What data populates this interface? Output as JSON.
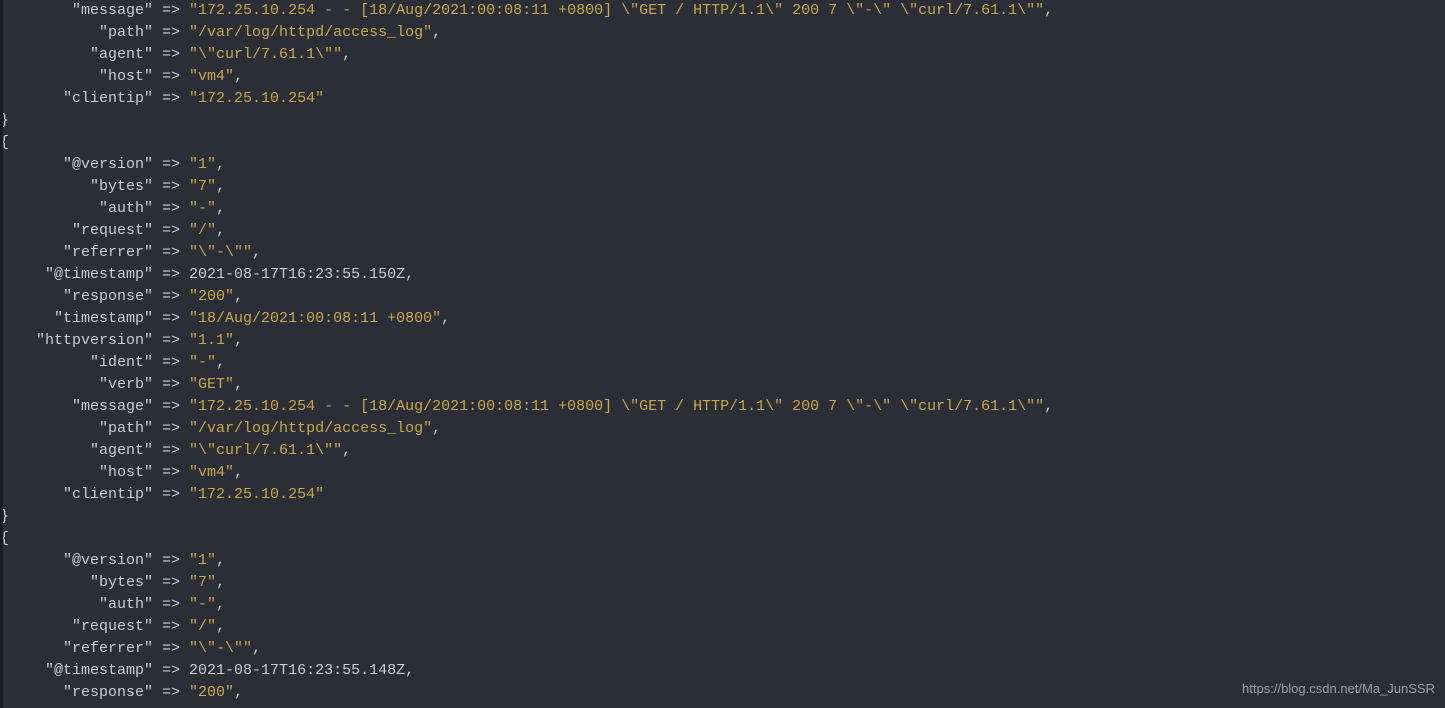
{
  "watermark": "https://blog.csdn.net/Ma_JunSSR",
  "block1_tail": [
    {
      "key": "\"message\"",
      "indent": 8,
      "arrow": " => ",
      "value": "\"172.25.10.254 - - [18/Aug/2021:00:08:11 +0800] \\\"GET / HTTP/1.1\\\" 200 7 \\\"-\\\" \\\"curl/7.61.1\\\"\"",
      "trail": ","
    },
    {
      "key": "\"path\"",
      "indent": 11,
      "arrow": " => ",
      "value": "\"/var/log/httpd/access_log\"",
      "trail": ","
    },
    {
      "key": "\"agent\"",
      "indent": 10,
      "arrow": " => ",
      "value": "\"\\\"curl/7.61.1\\\"\"",
      "trail": ","
    },
    {
      "key": "\"host\"",
      "indent": 11,
      "arrow": " => ",
      "value": "\"vm4\"",
      "trail": ","
    },
    {
      "key": "\"clientip\"",
      "indent": 7,
      "arrow": " => ",
      "value": "\"172.25.10.254\"",
      "trail": ""
    }
  ],
  "block2": [
    {
      "key": "\"@version\"",
      "indent": 7,
      "arrow": " => ",
      "value": "\"1\"",
      "trail": ","
    },
    {
      "key": "\"bytes\"",
      "indent": 10,
      "arrow": " => ",
      "value": "\"7\"",
      "trail": ","
    },
    {
      "key": "\"auth\"",
      "indent": 11,
      "arrow": " => ",
      "value": "\"-\"",
      "trail": ","
    },
    {
      "key": "\"request\"",
      "indent": 8,
      "arrow": " => ",
      "value": "\"/\"",
      "trail": ","
    },
    {
      "key": "\"referrer\"",
      "indent": 7,
      "arrow": " => ",
      "value": "\"\\\"-\\\"\"",
      "trail": ","
    },
    {
      "key": "\"@timestamp\"",
      "indent": 5,
      "arrow": " => ",
      "plain": "2021-08-17T16:23:55.150Z,"
    },
    {
      "key": "\"response\"",
      "indent": 7,
      "arrow": " => ",
      "value": "\"200\"",
      "trail": ","
    },
    {
      "key": "\"timestamp\"",
      "indent": 6,
      "arrow": " => ",
      "value": "\"18/Aug/2021:00:08:11 +0800\"",
      "trail": ","
    },
    {
      "key": "\"httpversion\"",
      "indent": 4,
      "arrow": " => ",
      "value": "\"1.1\"",
      "trail": ","
    },
    {
      "key": "\"ident\"",
      "indent": 10,
      "arrow": " => ",
      "value": "\"-\"",
      "trail": ","
    },
    {
      "key": "\"verb\"",
      "indent": 11,
      "arrow": " => ",
      "value": "\"GET\"",
      "trail": ","
    },
    {
      "key": "\"message\"",
      "indent": 8,
      "arrow": " => ",
      "value": "\"172.25.10.254 - - [18/Aug/2021:00:08:11 +0800] \\\"GET / HTTP/1.1\\\" 200 7 \\\"-\\\" \\\"curl/7.61.1\\\"\"",
      "trail": ","
    },
    {
      "key": "\"path\"",
      "indent": 11,
      "arrow": " => ",
      "value": "\"/var/log/httpd/access_log\"",
      "trail": ","
    },
    {
      "key": "\"agent\"",
      "indent": 10,
      "arrow": " => ",
      "value": "\"\\\"curl/7.61.1\\\"\"",
      "trail": ","
    },
    {
      "key": "\"host\"",
      "indent": 11,
      "arrow": " => ",
      "value": "\"vm4\"",
      "trail": ","
    },
    {
      "key": "\"clientip\"",
      "indent": 7,
      "arrow": " => ",
      "value": "\"172.25.10.254\"",
      "trail": ""
    }
  ],
  "block3_head": [
    {
      "key": "\"@version\"",
      "indent": 7,
      "arrow": " => ",
      "value": "\"1\"",
      "trail": ","
    },
    {
      "key": "\"bytes\"",
      "indent": 10,
      "arrow": " => ",
      "value": "\"7\"",
      "trail": ","
    },
    {
      "key": "\"auth\"",
      "indent": 11,
      "arrow": " => ",
      "value": "\"-\"",
      "trail": ","
    },
    {
      "key": "\"request\"",
      "indent": 8,
      "arrow": " => ",
      "value": "\"/\"",
      "trail": ","
    },
    {
      "key": "\"referrer\"",
      "indent": 7,
      "arrow": " => ",
      "value": "\"\\\"-\\\"\"",
      "trail": ","
    },
    {
      "key": "\"@timestamp\"",
      "indent": 5,
      "arrow": " => ",
      "plain": "2021-08-17T16:23:55.148Z,"
    },
    {
      "key": "\"response\"",
      "indent": 7,
      "arrow": " => ",
      "value": "\"200\"",
      "trail": ","
    }
  ]
}
